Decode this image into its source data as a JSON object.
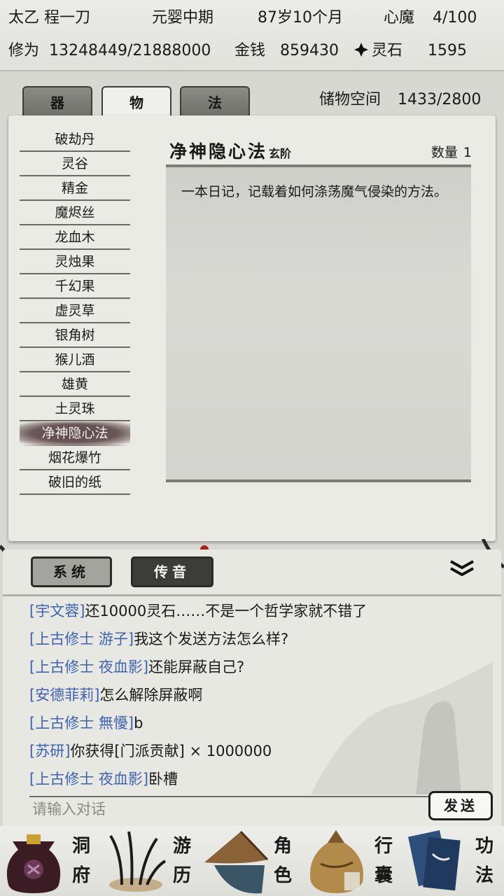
{
  "status": {
    "name": "太乙 程一刀",
    "realm": "元婴中期",
    "age": "87岁10个月",
    "demon_label": "心魔",
    "demon_value": "4/100",
    "cultivation_label": "修为",
    "cultivation_value": "13248449/21888000",
    "money_label": "金钱",
    "money_value": "859430",
    "spirit_stone_label": "灵石",
    "spirit_stone_value": "1595"
  },
  "inventory": {
    "tabs": [
      {
        "label": "器",
        "active": false
      },
      {
        "label": "物",
        "active": true
      },
      {
        "label": "法",
        "active": false
      }
    ],
    "storage_label": "储物空间",
    "storage_value": "1433/2800",
    "items": [
      {
        "label": "破劫丹"
      },
      {
        "label": "灵谷"
      },
      {
        "label": "精金"
      },
      {
        "label": "魔烬丝"
      },
      {
        "label": "龙血木"
      },
      {
        "label": "灵烛果"
      },
      {
        "label": "千幻果"
      },
      {
        "label": "虚灵草"
      },
      {
        "label": "银角树"
      },
      {
        "label": "猴儿酒"
      },
      {
        "label": "雄黄"
      },
      {
        "label": "土灵珠"
      },
      {
        "label": "净神隐心法",
        "selected": true
      },
      {
        "label": "烟花爆竹"
      },
      {
        "label": "破旧的纸"
      }
    ],
    "detail": {
      "name": "净神隐心法",
      "rank": "玄阶",
      "quantity_label": "数量",
      "quantity_value": "1",
      "description": "一本日记，记载着如何涤荡魔气侵染的方法。"
    }
  },
  "chat": {
    "tabs": [
      {
        "label": "系统",
        "active": false
      },
      {
        "label": "传音",
        "active": true
      }
    ],
    "messages": [
      {
        "user": "[宇文蓉]",
        "text": "还10000灵石……不是一个哲学家就不错了"
      },
      {
        "user": "[上古修士 游子]",
        "text": "我这个发送方法怎么样?"
      },
      {
        "user": "[上古修士 夜血影]",
        "text": "还能屏蔽自己?"
      },
      {
        "user": "[安德菲莉]",
        "text": "怎么解除屏蔽啊"
      },
      {
        "user": "[上古修士 無懮]",
        "text": "b"
      },
      {
        "user": "[苏研]",
        "text": "你获得[门派贡献] × 1000000"
      },
      {
        "user": "[上古修士 夜血影]",
        "text": "卧槽"
      }
    ],
    "input_placeholder": "请输入对话",
    "send_label": "发送"
  },
  "nav": [
    {
      "label_top": "洞",
      "label_bottom": "府",
      "icon": "treasure-bag-icon"
    },
    {
      "label_top": "游",
      "label_bottom": "历",
      "icon": "herb-icon"
    },
    {
      "label_top": "角",
      "label_bottom": "色",
      "icon": "straw-hat-icon"
    },
    {
      "label_top": "行",
      "label_bottom": "囊",
      "icon": "bundle-bag-icon"
    },
    {
      "label_top": "功",
      "label_bottom": "法",
      "icon": "books-icon"
    }
  ],
  "colors": {
    "username": "#3e63b0",
    "selected_item_bg": "#5a4848"
  }
}
